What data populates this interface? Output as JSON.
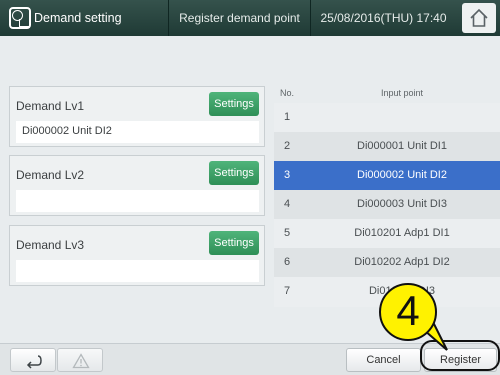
{
  "header": {
    "title": "Demand setting",
    "subtitle": "Register demand point",
    "datetime": "25/08/2016(THU) 17:40"
  },
  "demand_levels": [
    {
      "label": "Demand Lv1",
      "button": "Settings",
      "value": "Di000002 Unit DI2"
    },
    {
      "label": "Demand Lv2",
      "button": "Settings",
      "value": ""
    },
    {
      "label": "Demand Lv3",
      "button": "Settings",
      "value": ""
    }
  ],
  "table": {
    "headers": {
      "no": "No.",
      "input": "Input point"
    },
    "rows": [
      {
        "no": "1",
        "input": ""
      },
      {
        "no": "2",
        "input": "Di000001 Unit DI1"
      },
      {
        "no": "3",
        "input": "Di000002 Unit DI2",
        "selected": true
      },
      {
        "no": "4",
        "input": "Di000003 Unit DI3"
      },
      {
        "no": "5",
        "input": "Di010201 Adp1 DI1"
      },
      {
        "no": "6",
        "input": "Di010202 Adp1 DI2"
      },
      {
        "no": "7",
        "input": "Di0102… DI3"
      }
    ]
  },
  "footer": {
    "back_icon": "return-arrow-icon",
    "warning_icon": "warning-triangle-icon",
    "cancel": "Cancel",
    "register": "Register"
  },
  "callout": {
    "step": "4"
  },
  "colors": {
    "header": "#2a463f",
    "settings": "#3fa46a",
    "selected_row": "#3b6fc9",
    "callout": "#fff200"
  }
}
